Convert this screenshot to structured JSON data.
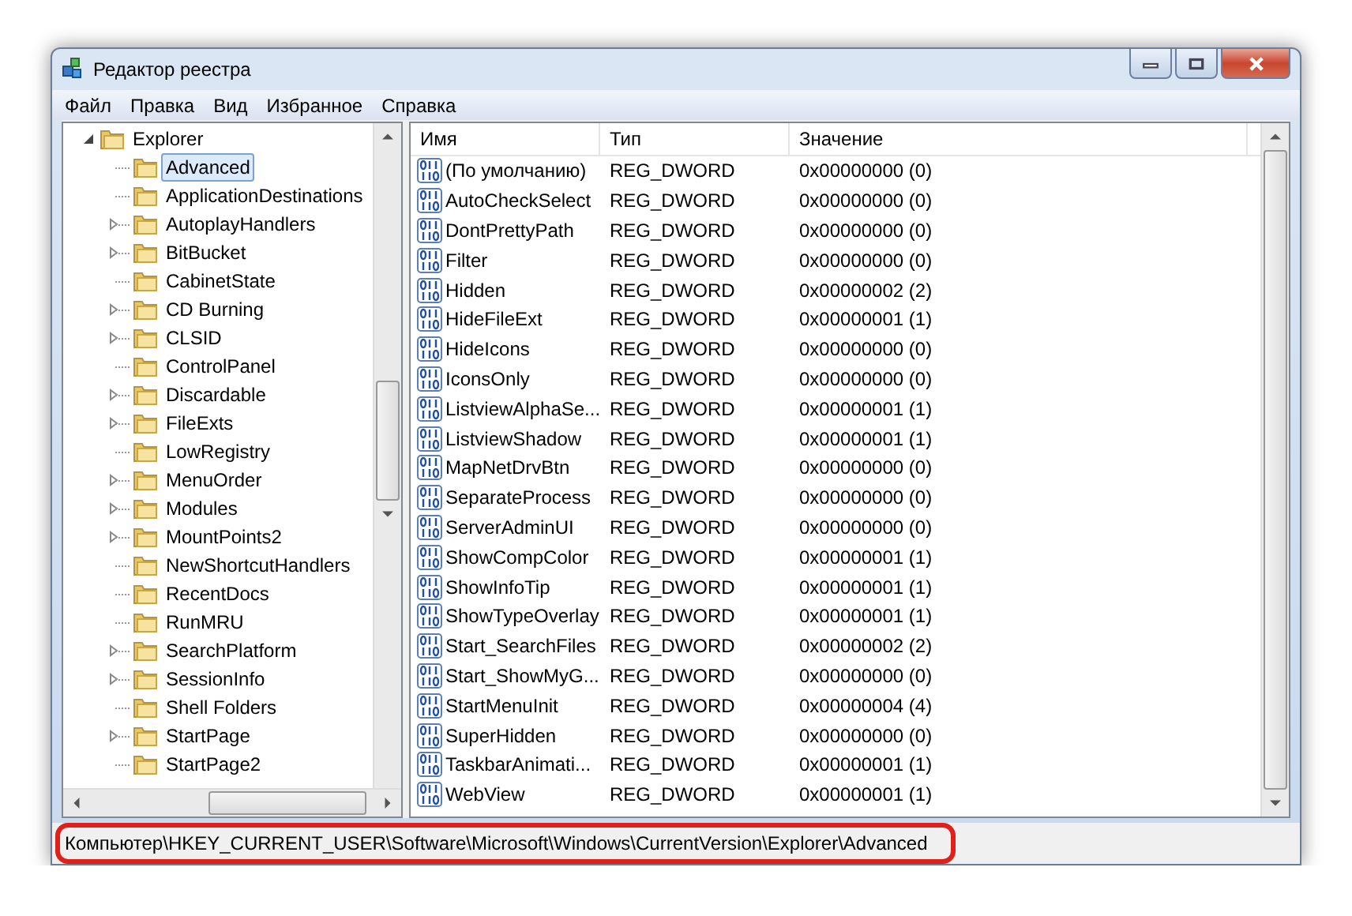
{
  "window": {
    "title": "Редактор реестра"
  },
  "menu": [
    "Файл",
    "Правка",
    "Вид",
    "Избранное",
    "Справка"
  ],
  "tree": [
    {
      "label": "Explorer",
      "expanded": true,
      "selected": false,
      "children": [
        {
          "label": "Advanced",
          "has_children": false,
          "selected": true
        },
        {
          "label": "ApplicationDestinations",
          "has_children": false,
          "selected": false
        },
        {
          "label": "AutoplayHandlers",
          "has_children": true,
          "selected": false
        },
        {
          "label": "BitBucket",
          "has_children": true,
          "selected": false
        },
        {
          "label": "CabinetState",
          "has_children": false,
          "selected": false
        },
        {
          "label": "CD Burning",
          "has_children": true,
          "selected": false
        },
        {
          "label": "CLSID",
          "has_children": true,
          "selected": false
        },
        {
          "label": "ControlPanel",
          "has_children": false,
          "selected": false
        },
        {
          "label": "Discardable",
          "has_children": true,
          "selected": false
        },
        {
          "label": "FileExts",
          "has_children": true,
          "selected": false
        },
        {
          "label": "LowRegistry",
          "has_children": false,
          "selected": false
        },
        {
          "label": "MenuOrder",
          "has_children": true,
          "selected": false
        },
        {
          "label": "Modules",
          "has_children": true,
          "selected": false
        },
        {
          "label": "MountPoints2",
          "has_children": true,
          "selected": false
        },
        {
          "label": "NewShortcutHandlers",
          "has_children": false,
          "selected": false
        },
        {
          "label": "RecentDocs",
          "has_children": false,
          "selected": false
        },
        {
          "label": "RunMRU",
          "has_children": false,
          "selected": false
        },
        {
          "label": "SearchPlatform",
          "has_children": true,
          "selected": false
        },
        {
          "label": "SessionInfo",
          "has_children": true,
          "selected": false
        },
        {
          "label": "Shell Folders",
          "has_children": false,
          "selected": false
        },
        {
          "label": "StartPage",
          "has_children": true,
          "selected": false
        },
        {
          "label": "StartPage2",
          "has_children": false,
          "selected": false
        }
      ]
    }
  ],
  "table": {
    "columns": [
      "Имя",
      "Тип",
      "Значение"
    ],
    "rows": [
      [
        "(По умолчанию)",
        "REG_DWORD",
        "0x00000000 (0)"
      ],
      [
        "AutoCheckSelect",
        "REG_DWORD",
        "0x00000000 (0)"
      ],
      [
        "DontPrettyPath",
        "REG_DWORD",
        "0x00000000 (0)"
      ],
      [
        "Filter",
        "REG_DWORD",
        "0x00000000 (0)"
      ],
      [
        "Hidden",
        "REG_DWORD",
        "0x00000002 (2)"
      ],
      [
        "HideFileExt",
        "REG_DWORD",
        "0x00000001 (1)"
      ],
      [
        "HideIcons",
        "REG_DWORD",
        "0x00000000 (0)"
      ],
      [
        "IconsOnly",
        "REG_DWORD",
        "0x00000000 (0)"
      ],
      [
        "ListviewAlphaSe...",
        "REG_DWORD",
        "0x00000001 (1)"
      ],
      [
        "ListviewShadow",
        "REG_DWORD",
        "0x00000001 (1)"
      ],
      [
        "MapNetDrvBtn",
        "REG_DWORD",
        "0x00000000 (0)"
      ],
      [
        "SeparateProcess",
        "REG_DWORD",
        "0x00000000 (0)"
      ],
      [
        "ServerAdminUI",
        "REG_DWORD",
        "0x00000000 (0)"
      ],
      [
        "ShowCompColor",
        "REG_DWORD",
        "0x00000001 (1)"
      ],
      [
        "ShowInfoTip",
        "REG_DWORD",
        "0x00000001 (1)"
      ],
      [
        "ShowTypeOverlay",
        "REG_DWORD",
        "0x00000001 (1)"
      ],
      [
        "Start_SearchFiles",
        "REG_DWORD",
        "0x00000002 (2)"
      ],
      [
        "Start_ShowMyG...",
        "REG_DWORD",
        "0x00000000 (0)"
      ],
      [
        "StartMenuInit",
        "REG_DWORD",
        "0x00000004 (4)"
      ],
      [
        "SuperHidden",
        "REG_DWORD",
        "0x00000000 (0)"
      ],
      [
        "TaskbarAnimati...",
        "REG_DWORD",
        "0x00000001 (1)"
      ],
      [
        "WebView",
        "REG_DWORD",
        "0x00000001 (1)"
      ]
    ]
  },
  "status_bar": {
    "path": "Компьютер\\HKEY_CURRENT_USER\\Software\\Microsoft\\Windows\\CurrentVersion\\Explorer\\Advanced",
    "highlighted": true
  }
}
